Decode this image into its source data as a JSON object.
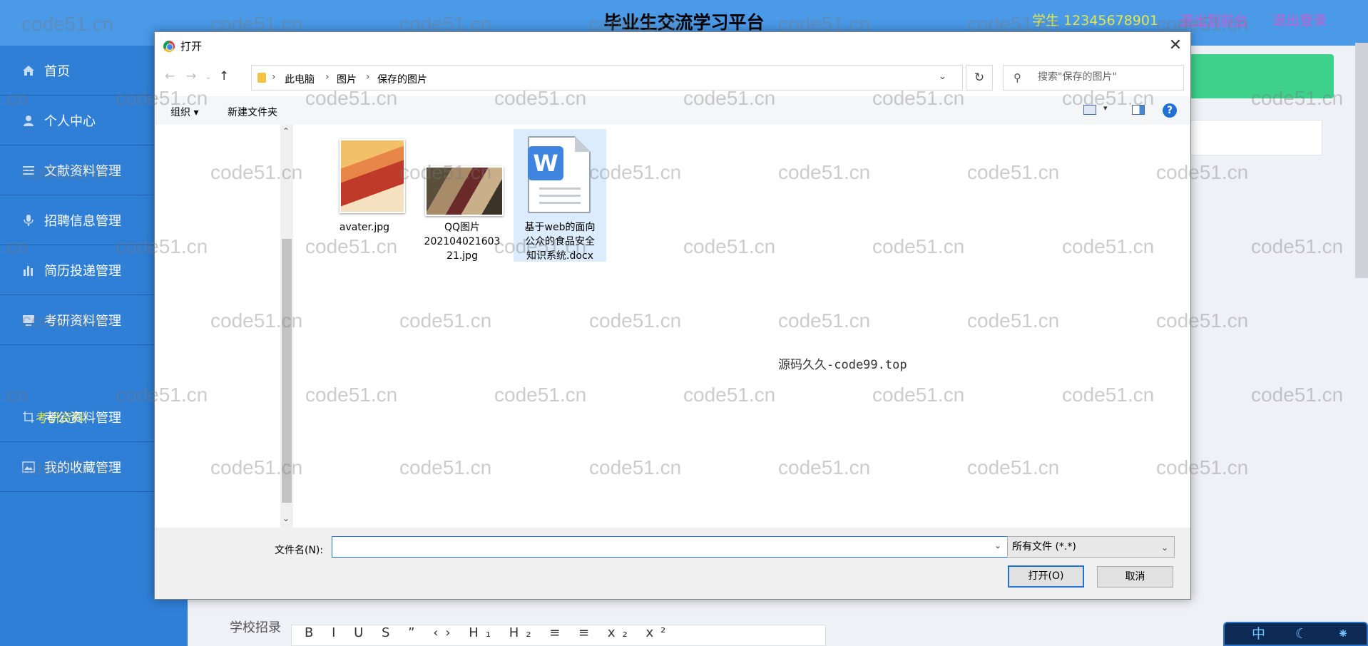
{
  "app": {
    "title": "毕业生交流学习平台",
    "user_info": "学生 12345678901",
    "backend_link": "退出到前台",
    "logout_link": "退出登录"
  },
  "sidebar": {
    "items": [
      {
        "label": "首页",
        "icon": "home-icon"
      },
      {
        "label": "个人中心",
        "icon": "user-icon"
      },
      {
        "label": "文献资料管理",
        "icon": "list-icon"
      },
      {
        "label": "招聘信息管理",
        "icon": "mic-icon"
      },
      {
        "label": "简历投递管理",
        "icon": "bar-chart-icon"
      },
      {
        "label": "考研资料管理",
        "icon": "monitor-icon"
      },
      {
        "label": "考公资料管理",
        "icon": "crop-icon"
      },
      {
        "label": "我的收藏管理",
        "icon": "image-icon"
      }
    ],
    "sub_item": "考研资料"
  },
  "main": {
    "school_label": "学校招录",
    "editor_tools": "B I U S ” ‹› H₁ H₂ ≡ ≡ x₂ x²"
  },
  "ime": {
    "text": "中 ☾ ⁕ ⚙"
  },
  "dialog": {
    "title": "打开",
    "breadcrumbs": [
      "此电脑",
      "图片",
      "保存的图片"
    ],
    "search_placeholder": "搜索\"保存的图片\"",
    "commands": {
      "organize": "组织 ▾",
      "new_folder": "新建文件夹"
    },
    "files": [
      {
        "name": "avater.jpg",
        "type": "image"
      },
      {
        "name": "QQ图片20210402160321.jpg",
        "type": "image"
      },
      {
        "name": "基于web的面向公众的食品安全知识系统.docx",
        "type": "word"
      }
    ],
    "file_name_lines": [
      [
        "avater.jpg"
      ],
      [
        "QQ图片",
        "202104021603",
        "21.jpg"
      ],
      [
        "基于web的面向",
        "公众的食品安全",
        "知识系统.docx"
      ]
    ],
    "center_text": "源码久久-code99.top",
    "filename_label": "文件名(N):",
    "filename_value": "",
    "filetype_value": "所有文件 (*.*)",
    "open_button": "打开(O)",
    "cancel_button": "取消"
  },
  "watermark": "code51.cn",
  "colors": {
    "sidebar_bg": "#2f7fd6",
    "topbar_bg": "#4a9ae8",
    "accent_yellow": "#e6e84a",
    "link_purple": "#c65cd1",
    "green_button": "#3dd18b",
    "dialog_focus_blue": "#1e72d6"
  }
}
